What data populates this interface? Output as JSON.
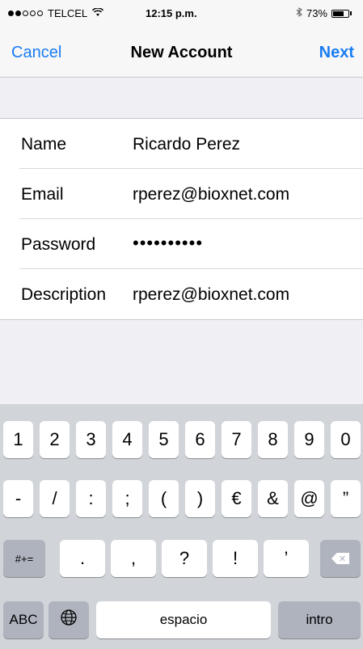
{
  "status_bar": {
    "carrier": "TELCEL",
    "time": "12:15 p.m.",
    "battery": "73%",
    "battery_level": 0.73,
    "signal_bars": 2,
    "icons": [
      "wifi-icon",
      "bluetooth-icon",
      "battery-icon"
    ]
  },
  "nav": {
    "cancel_label": "Cancel",
    "title": "New Account",
    "next_label": "Next",
    "accent_color": "#1a7cf2"
  },
  "form": {
    "rows": [
      {
        "label": "Name",
        "value": "Ricardo Perez"
      },
      {
        "label": "Email",
        "value": "rperez@bioxnet.com"
      },
      {
        "label": "Password",
        "value": "••••••••••"
      },
      {
        "label": "Description",
        "value": "rperez@bioxnet.com"
      }
    ]
  },
  "keyboard": {
    "row1": [
      "1",
      "2",
      "3",
      "4",
      "5",
      "6",
      "7",
      "8",
      "9",
      "0"
    ],
    "row2": [
      "-",
      "/",
      ":",
      ";",
      "(",
      ")",
      "€",
      "&",
      "@",
      "”"
    ],
    "row3": {
      "symbols_toggle": "#+=",
      "keys": [
        ".",
        ",",
        "?",
        "!",
        "’"
      ],
      "delete_icon": "delete-icon"
    },
    "row4": {
      "abc_label": "ABC",
      "globe_icon": "globe-icon",
      "space_label": "espacio",
      "return_label": "intro"
    }
  }
}
